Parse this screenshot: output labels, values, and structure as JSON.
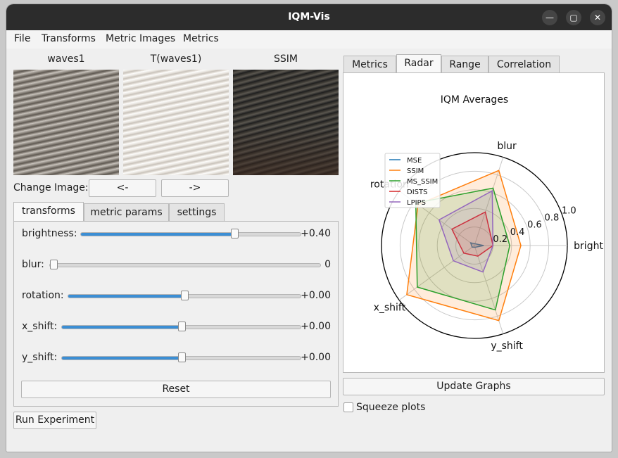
{
  "window": {
    "title": "IQM-Vis"
  },
  "menus": [
    "File",
    "Transforms",
    "Metric Images",
    "Metrics"
  ],
  "images": [
    {
      "label": "waves1"
    },
    {
      "label": "T(waves1)"
    },
    {
      "label": "SSIM"
    }
  ],
  "change_image": {
    "label": "Change Image:",
    "prev": "<-",
    "next": "->"
  },
  "left_tabs": [
    "transforms",
    "metric params",
    "settings"
  ],
  "sliders": [
    {
      "name": "brightness",
      "label": "brightness:",
      "value": "+0.40",
      "fraction": 0.7
    },
    {
      "name": "blur",
      "label": "blur:",
      "value": "0",
      "fraction": 0.0
    },
    {
      "name": "rotation",
      "label": "rotation:",
      "value": "+0.00",
      "fraction": 0.5
    },
    {
      "name": "x-shift",
      "label": "x_shift:",
      "value": "+0.00",
      "fraction": 0.5
    },
    {
      "name": "y-shift",
      "label": "y_shift:",
      "value": "+0.00",
      "fraction": 0.5
    }
  ],
  "reset_label": "Reset",
  "run_label": "Run Experiment",
  "right_tabs": [
    "Metrics",
    "Radar",
    "Range",
    "Correlation"
  ],
  "update_label": "Update Graphs",
  "squeeze_label": "Squeeze plots",
  "colors": {
    "accent": "#3b8ed4",
    "titlebar": "#2c2c2c",
    "mse": "#1f77b4",
    "ssim": "#ff7f0e",
    "ms_ssim": "#2ca02c",
    "dists": "#d62728",
    "lpips": "#9467bd"
  },
  "chart_data": {
    "type": "radar",
    "title": "IQM Averages",
    "axes": [
      "brightness",
      "blur",
      "rotation",
      "x_shift",
      "y_shift"
    ],
    "axis_labels": [
      "brightne",
      "blur",
      "rotation",
      "x_shift",
      "y_shift"
    ],
    "rlim": [
      0,
      1.0
    ],
    "rticks": [
      "0.2",
      "0.4",
      "0.6",
      "0.8",
      "1.0"
    ],
    "legend_position": "upper-left",
    "series": [
      {
        "name": "MSE",
        "values": [
          0.1,
          0.02,
          0.05,
          0.03,
          0.02
        ],
        "color": "#1f77b4"
      },
      {
        "name": "SSIM",
        "values": [
          0.5,
          0.85,
          0.75,
          0.9,
          0.85
        ],
        "color": "#ff7f0e"
      },
      {
        "name": "MS_SSIM",
        "values": [
          0.38,
          0.65,
          0.78,
          0.76,
          0.73
        ],
        "color": "#2ca02c"
      },
      {
        "name": "DISTS",
        "values": [
          0.2,
          0.38,
          0.3,
          0.14,
          0.12
        ],
        "color": "#d62728"
      },
      {
        "name": "LPIPS",
        "values": [
          0.2,
          0.62,
          0.47,
          0.28,
          0.3
        ],
        "color": "#9467bd"
      }
    ]
  }
}
